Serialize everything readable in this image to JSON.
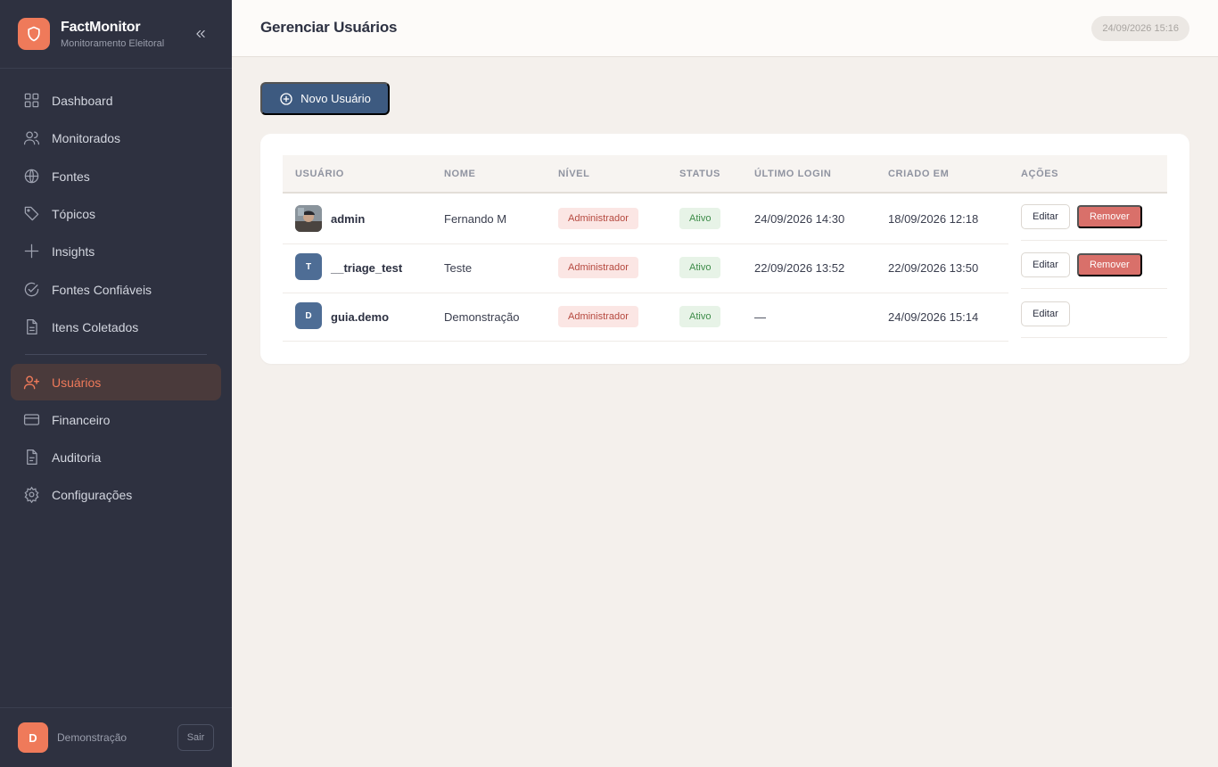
{
  "brand": {
    "title": "FactMonitor",
    "subtitle": "Monitoramento Eleitoral",
    "logo_icon": "shield-icon",
    "accent": "#ef7a5a"
  },
  "sidebar": {
    "items": [
      {
        "label": "Dashboard",
        "icon": "grid-icon"
      },
      {
        "label": "Monitorados",
        "icon": "users-icon"
      },
      {
        "label": "Fontes",
        "icon": "globe-icon"
      },
      {
        "label": "Tópicos",
        "icon": "tag-icon"
      },
      {
        "label": "Insights",
        "icon": "plus-icon"
      },
      {
        "label": "Fontes Confiáveis",
        "icon": "check-circle-icon"
      },
      {
        "label": "Itens Coletados",
        "icon": "document-icon"
      },
      {
        "label": "Usuários",
        "icon": "user-plus-icon",
        "active": true
      },
      {
        "label": "Financeiro",
        "icon": "credit-card-icon"
      },
      {
        "label": "Auditoria",
        "icon": "file-text-icon"
      },
      {
        "label": "Configurações",
        "icon": "gear-icon"
      }
    ],
    "user": {
      "initial": "D",
      "name": "Demonstração",
      "logout_label": "Sair"
    }
  },
  "header": {
    "title": "Gerenciar Usuários",
    "datetime": "24/09/2026 15:16"
  },
  "main": {
    "new_user_label": "Novo Usuário",
    "table": {
      "columns": [
        "USUÁRIO",
        "NOME",
        "NÍVEL",
        "STATUS",
        "ÚLTIMO LOGIN",
        "CRIADO EM",
        "AÇÕES"
      ],
      "rows": [
        {
          "avatar": "photo",
          "initial": "",
          "username": "admin",
          "name": "Fernando M",
          "level": "Administrador",
          "status": "Ativo",
          "last_login": "24/09/2026 14:30",
          "created": "18/09/2026 12:18",
          "edit_label": "Editar",
          "remove_label": "Remover"
        },
        {
          "avatar": "initial",
          "initial": "T",
          "username": "__triage_test",
          "name": "Teste",
          "level": "Administrador",
          "status": "Ativo",
          "last_login": "22/09/2026 13:52",
          "created": "22/09/2026 13:50",
          "edit_label": "Editar",
          "remove_label": "Remover"
        },
        {
          "avatar": "initial",
          "initial": "D",
          "username": "guia.demo",
          "name": "Demonstração",
          "level": "Administrador",
          "status": "Ativo",
          "last_login": "—",
          "created": "24/09/2026 15:14",
          "edit_label": "Editar",
          "remove_label": ""
        }
      ]
    }
  }
}
